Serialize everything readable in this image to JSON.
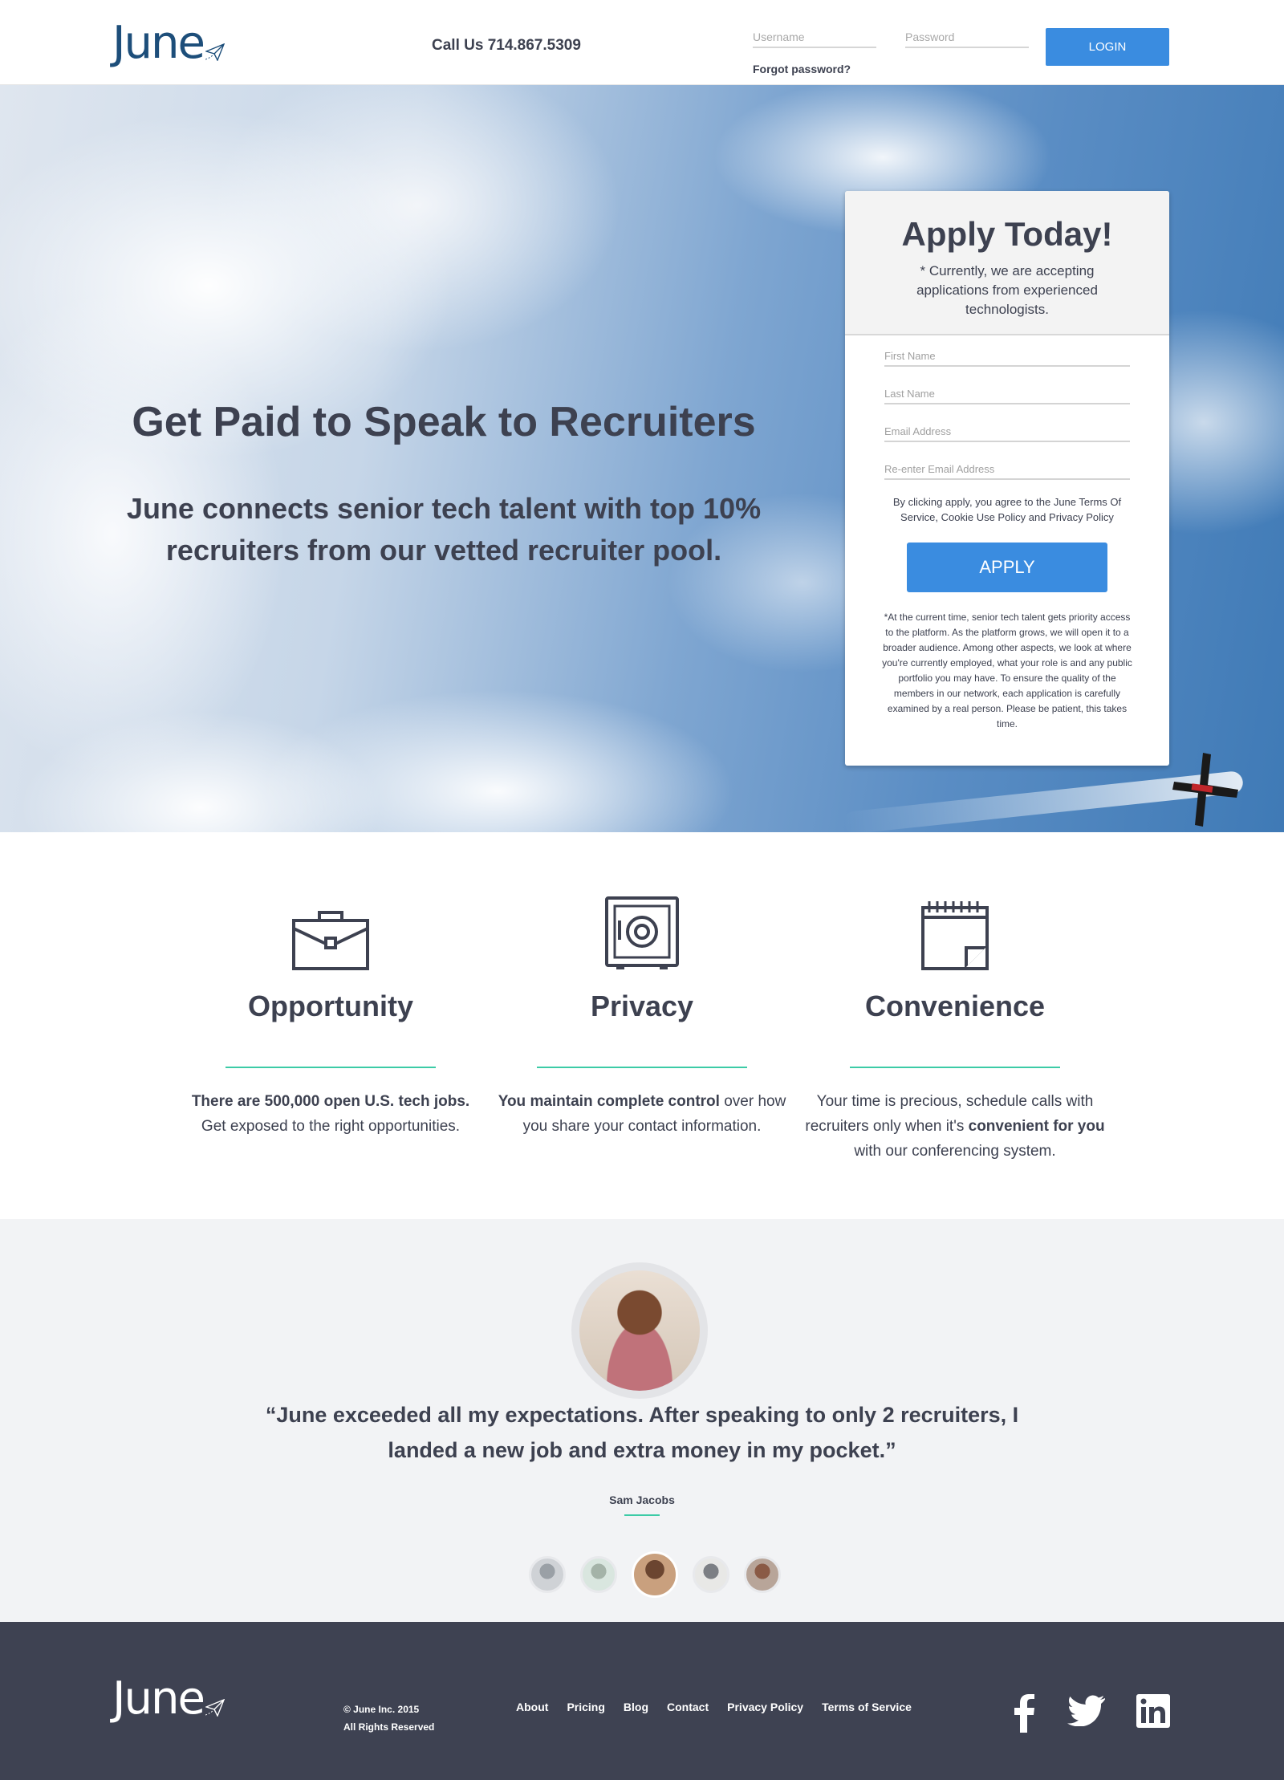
{
  "header": {
    "logo": "June",
    "phone": "Call Us 714.867.5309",
    "username_placeholder": "Username",
    "password_placeholder": "Password",
    "forgot_password": "Forgot password?",
    "login_label": "LOGIN"
  },
  "hero": {
    "title": "Get Paid to Speak to Recruiters",
    "subtitle": "June connects senior tech talent with top 10% recruiters from our vetted recruiter pool."
  },
  "apply": {
    "title": "Apply Today!",
    "note": "* Currently, we are accepting applications from experienced technologists.",
    "first_name_placeholder": "First Name",
    "last_name_placeholder": "Last Name",
    "email_placeholder": "Email Address",
    "reemail_placeholder": "Re-enter Email Address",
    "terms": "By clicking apply, you agree to the June Terms Of Service, Cookie Use Policy and Privacy Policy",
    "button": "APPLY",
    "fine_print": "*At the current time, senior tech talent gets priority access to the platform. As the platform grows, we will open it to a broader audience. Among other aspects, we look at where you're currently employed, what your role is and any public portfolio you may have. To ensure the quality of the members in our network, each application is carefully examined by a real person. Please be patient, this takes time."
  },
  "features": [
    {
      "icon": "briefcase-icon",
      "title": "Opportunity",
      "text_bold": "There are 500,000 open U.S. tech jobs.",
      "text_rest": "Get exposed to the right opportunities."
    },
    {
      "icon": "safe-icon",
      "title": "Privacy",
      "text_bold": "You maintain complete control",
      "text_rest": "over how you share your contact information."
    },
    {
      "icon": "calendar-icon",
      "title": "Convenience",
      "text_pre": "Your time is precious, schedule calls with recruiters only when it's",
      "text_bold": "convenient for you",
      "text_rest": "with our conferencing system."
    }
  ],
  "testimonial": {
    "quote": "“June exceeded all my expectations.  After speaking to only 2 recruiters, I landed a new job and extra money in my pocket.”",
    "author": "Sam Jacobs",
    "thumbnails": 5,
    "active_index": 2
  },
  "footer": {
    "logo": "June",
    "copyright": "© June Inc. 2015",
    "rights": "All Rights Reserved",
    "links": [
      "About",
      "Pricing",
      "Blog",
      "Contact",
      "Privacy Policy",
      "Terms of Service"
    ],
    "social": [
      "facebook-icon",
      "twitter-icon",
      "linkedin-icon"
    ]
  },
  "colors": {
    "accent_blue": "#3a8ce0",
    "brand_navy": "#1d4e7a",
    "text_dark": "#3d4150",
    "teal_rule": "#3ccba6",
    "footer_bg": "#3e4252"
  }
}
